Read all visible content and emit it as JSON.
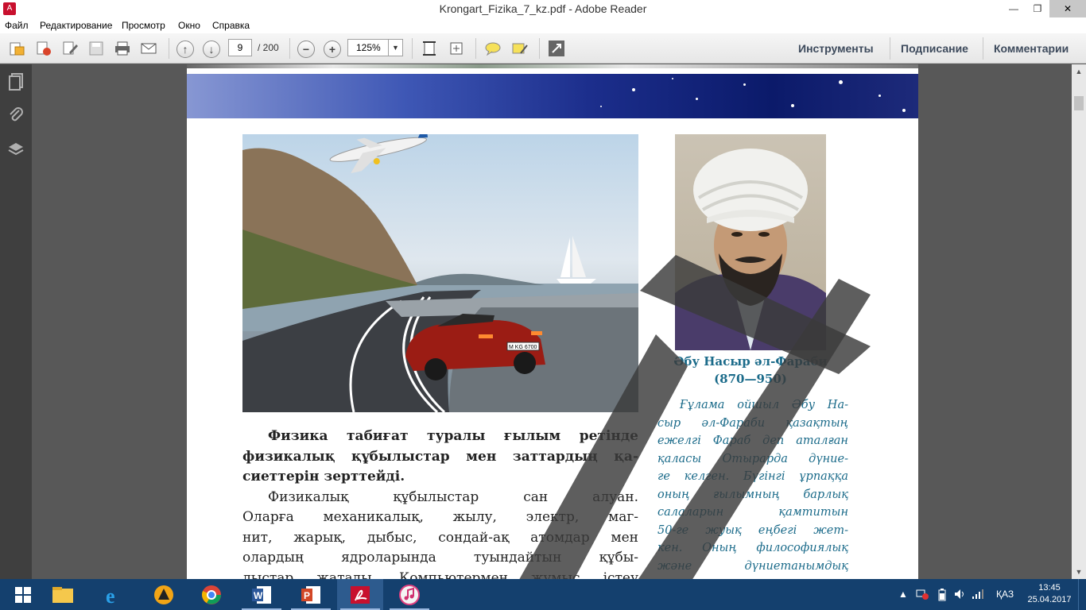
{
  "window": {
    "title": "Krongart_Fizika_7_kz.pdf - Adobe Reader"
  },
  "menu": [
    "Файл",
    "Редактирование",
    "Просмотр",
    "Окно",
    "Справка"
  ],
  "toolbar": {
    "page_current": "9",
    "page_total": "/ 200",
    "zoom": "125%",
    "right_tabs": [
      "Инструменты",
      "Подписание",
      "Комментарии"
    ]
  },
  "document": {
    "caption_name": "Әбу Насыр әл-Фараби",
    "caption_years": "(870—950)",
    "sidebar_lines": [
      "Ғұлама ойшыл Әбу На-",
      "сыр әл-Фараби қазақтың",
      "ежелгі Фараб деп аталған",
      "қаласы Отырарда дүние-",
      "ге келген. Бүгінгі ұрпаққа",
      "оның ғылымның барлық",
      "салаларын қамтитын",
      "50-ге жуық еңбегі жет-",
      "кен. Оның философиялық",
      "және дүниетанымдық"
    ],
    "main_lines": [
      "Физика табиғат туралы ғылым ретінде",
      "физикалық құбылыстар мен заттардың қа-",
      "сиеттерін зерттейді.",
      "Физикалық құбылыстар сан алуан.",
      "Оларға механикалық, жылу, электр, маг-",
      "нит, жарық, дыбыс, сондай-ақ атомдар мен",
      "олардың ядроларында туындайтын құбы-",
      "лыстар жатады. Компьютермен жұмыс істеу"
    ],
    "car_plate": "M KG 6700"
  },
  "taskbar": {
    "language": "ҚАЗ",
    "time": "13:45",
    "date": "25.04.2017"
  },
  "colors": {
    "caption": "#1b6b8a",
    "watermark": "#3a3a3a",
    "taskbar": "#14406e"
  }
}
